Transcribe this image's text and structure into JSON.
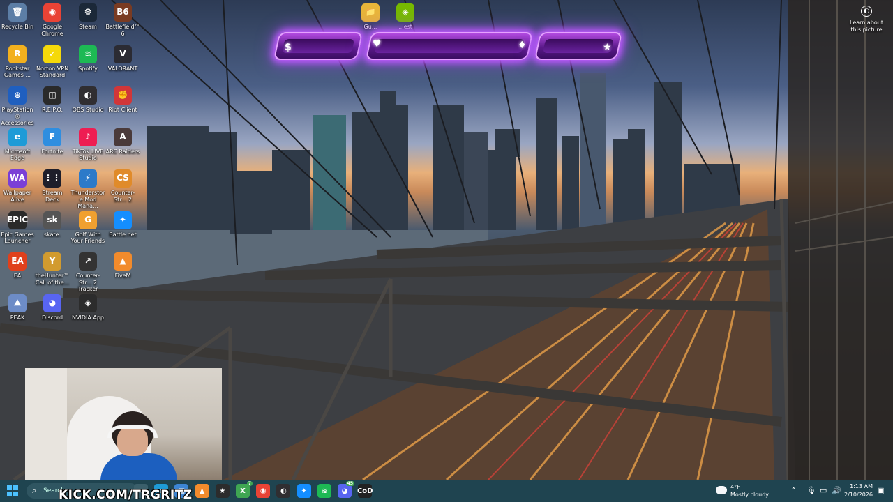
{
  "desktop": {
    "icons": [
      {
        "label": "Recycle Bin",
        "glyph": "🗑",
        "color": "#5c7ea6"
      },
      {
        "label": "Google Chrome",
        "glyph": "◉",
        "color": "#e94335"
      },
      {
        "label": "Steam",
        "glyph": "⚙",
        "color": "#1b2838"
      },
      {
        "label": "Battlefield™ 6",
        "glyph": "B6",
        "color": "#7a3b22"
      },
      {
        "label": "Rockstar Games ...",
        "glyph": "R",
        "color": "#f2b01e"
      },
      {
        "label": "Norton VPN Standard",
        "glyph": "✓",
        "color": "#f5d90a"
      },
      {
        "label": "Spotify",
        "glyph": "≋",
        "color": "#1db954"
      },
      {
        "label": "VALORANT",
        "glyph": "V",
        "color": "#2b2b33"
      },
      {
        "label": "PlayStation® Accessories",
        "glyph": "⊕",
        "color": "#1f5fbf"
      },
      {
        "label": "R.E.P.O.",
        "glyph": "◫",
        "color": "#2a2a2a"
      },
      {
        "label": "OBS Studio",
        "glyph": "◐",
        "color": "#302e31"
      },
      {
        "label": "Riot Client",
        "glyph": "✊",
        "color": "#d13639"
      },
      {
        "label": "Microsoft Edge",
        "glyph": "e",
        "color": "#1e9bd7"
      },
      {
        "label": "Fortnite",
        "glyph": "F",
        "color": "#2f8ee0"
      },
      {
        "label": "TikTok LIVE Studio",
        "glyph": "♪",
        "color": "#ee1d52"
      },
      {
        "label": "ARC Raiders",
        "glyph": "A",
        "color": "#4a3a3a"
      },
      {
        "label": "Wallpaper Alive",
        "glyph": "WA",
        "color": "#7a3fd6"
      },
      {
        "label": "Stream Deck",
        "glyph": "⋮⋮",
        "color": "#1e1e2a"
      },
      {
        "label": "Thunderstore Mod Mana...",
        "glyph": "⚡",
        "color": "#2c7ac9"
      },
      {
        "label": "Counter-Str... 2",
        "glyph": "CS",
        "color": "#e08b2a"
      },
      {
        "label": "Epic Games Launcher",
        "glyph": "EPIC",
        "color": "#2a2a2a"
      },
      {
        "label": "skate.",
        "glyph": "sk",
        "color": "#555"
      },
      {
        "label": "Golf With Your Friends",
        "glyph": "G",
        "color": "#f0a030"
      },
      {
        "label": "Battle.net",
        "glyph": "✦",
        "color": "#148eff"
      },
      {
        "label": "EA",
        "glyph": "EA",
        "color": "#e0401c"
      },
      {
        "label": "theHunter™ Call of the...",
        "glyph": "Y",
        "color": "#d29b2e"
      },
      {
        "label": "Counter-Str... 2 Tracker",
        "glyph": "↗",
        "color": "#333"
      },
      {
        "label": "FiveM",
        "glyph": "▲",
        "color": "#f28b2c"
      },
      {
        "label": "PEAK",
        "glyph": "⛰",
        "color": "#6d8cc7"
      },
      {
        "label": "Discord",
        "glyph": "◕",
        "color": "#5865f2"
      },
      {
        "label": "NVIDIA App",
        "glyph": "◈",
        "color": "#2c2c2c"
      }
    ],
    "top_icons": [
      {
        "label": "Gu...",
        "glyph": "📁",
        "color": "#e8b53a"
      },
      {
        "label": "...est",
        "glyph": "◈",
        "color": "#76b900"
      }
    ],
    "learn_about": "Learn about this picture"
  },
  "hud": {
    "left_symbol": "$",
    "heart_symbol": "♥",
    "diamond_symbol": "♦",
    "star_symbol": "★"
  },
  "stream": {
    "kick_url": "KICK.COM/TRGRITZ"
  },
  "taskbar": {
    "search_placeholder": "Search",
    "apps": [
      {
        "name": "task-view",
        "glyph": "▭",
        "color": "#3b5f6b"
      },
      {
        "name": "edge",
        "glyph": "e",
        "color": "#1e9bd7"
      },
      {
        "name": "store",
        "glyph": "▦",
        "color": "#3d86d4"
      },
      {
        "name": "fivem",
        "glyph": "▲",
        "color": "#f28b2c"
      },
      {
        "name": "star-app",
        "glyph": "★",
        "color": "#2c2c2c"
      },
      {
        "name": "xbox",
        "glyph": "X",
        "color": "#3fa652",
        "badge": "7"
      },
      {
        "name": "chrome",
        "glyph": "◉",
        "color": "#e94335"
      },
      {
        "name": "obs",
        "glyph": "◐",
        "color": "#302e31"
      },
      {
        "name": "battlenet",
        "glyph": "✦",
        "color": "#148eff"
      },
      {
        "name": "spotify",
        "glyph": "≋",
        "color": "#1db954"
      },
      {
        "name": "discord",
        "glyph": "◕",
        "color": "#5865f2",
        "badge": "45"
      },
      {
        "name": "call-of-duty",
        "glyph": "CoD",
        "color": "#222"
      }
    ],
    "weather": {
      "temp": "4°F",
      "condition": "Mostly cloudy"
    },
    "clock": {
      "time": "1:13 AM",
      "date": "2/10/2026"
    }
  }
}
